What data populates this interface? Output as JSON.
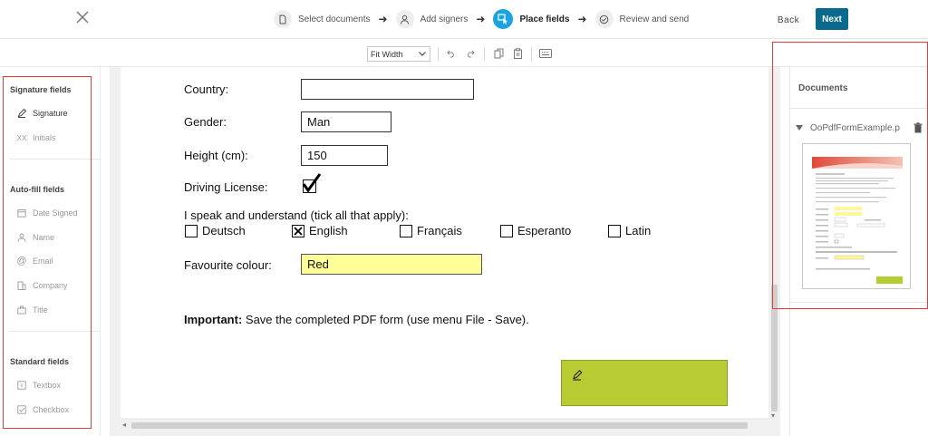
{
  "header": {
    "steps": [
      {
        "label": "Select documents",
        "icon": "document-icon"
      },
      {
        "label": "Add signers",
        "icon": "person-icon"
      },
      {
        "label": "Place fields",
        "icon": "place-fields-icon"
      },
      {
        "label": "Review and send",
        "icon": "check-circle-icon"
      }
    ],
    "back_label": "Back",
    "next_label": "Next",
    "accent_color": "#1ba3e0",
    "next_button_color": "#0b6a8c"
  },
  "toolbar": {
    "zoom_value": "Fit Width"
  },
  "sidebar": {
    "signature_section": "Signature fields",
    "signature_items": [
      {
        "label": "Signature",
        "icon": "pen-icon"
      },
      {
        "label": "Initials",
        "icon": "initials-icon"
      }
    ],
    "autofill_section": "Auto-fill fields",
    "autofill_items": [
      {
        "label": "Date Signed",
        "icon": "calendar-icon"
      },
      {
        "label": "Name",
        "icon": "person-icon"
      },
      {
        "label": "Email",
        "icon": "at-icon"
      },
      {
        "label": "Company",
        "icon": "building-icon"
      },
      {
        "label": "Title",
        "icon": "briefcase-icon"
      }
    ],
    "standard_section": "Standard fields",
    "standard_items": [
      {
        "label": "Textbox",
        "icon": "textbox-icon"
      },
      {
        "label": "Checkbox",
        "icon": "checkbox-icon"
      }
    ]
  },
  "pdf": {
    "country_label": "Country:",
    "country_value": "",
    "gender_label": "Gender:",
    "gender_value": "Man",
    "height_label": "Height (cm):",
    "height_value": "150",
    "driving_label": "Driving License:",
    "driving_checked": true,
    "speak_label": "I speak and understand (tick all that apply):",
    "languages": [
      {
        "label": "Deutsch",
        "checked": false
      },
      {
        "label": "English",
        "checked": true
      },
      {
        "label": "Français",
        "checked": false
      },
      {
        "label": "Esperanto",
        "checked": false
      },
      {
        "label": "Latin",
        "checked": false
      }
    ],
    "colour_label": "Favourite colour:",
    "colour_value": "Red",
    "important_bold": "Important:",
    "important_text": " Save the completed PDF form (use menu File - Save).",
    "signature_field_color": "#b7cc32"
  },
  "documents": {
    "title": "Documents",
    "doc_name": "OoPdfFormExample.p",
    "thumb_header": "Foersom"
  }
}
